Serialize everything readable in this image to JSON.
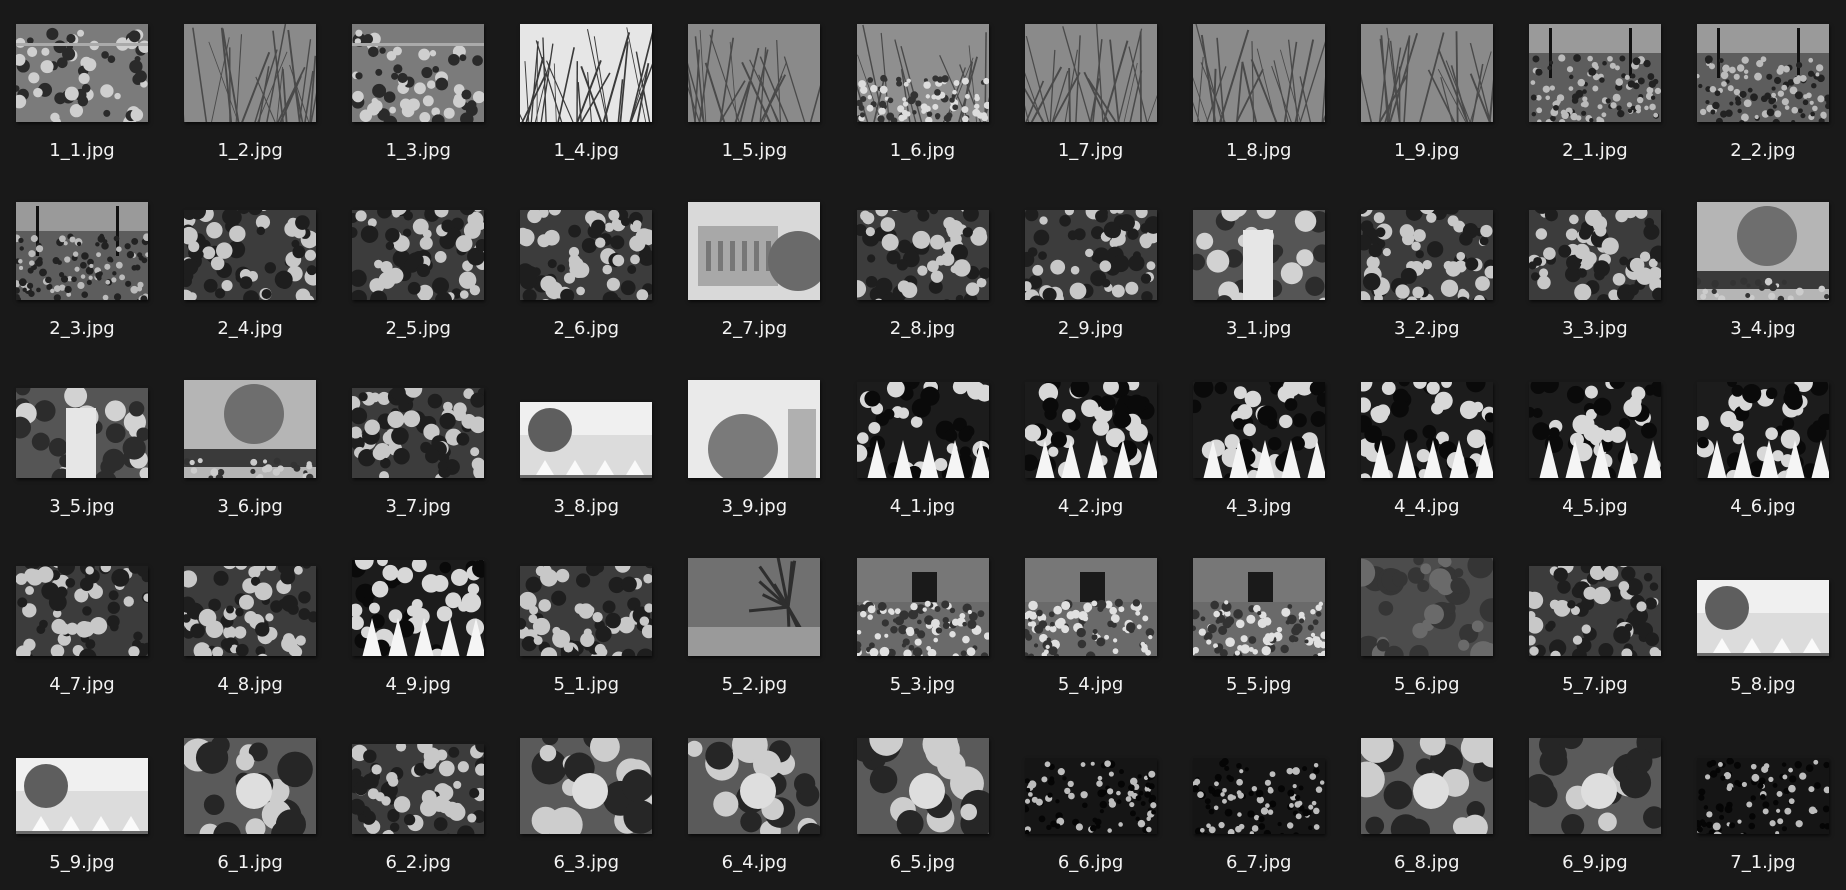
{
  "files": [
    {
      "name": "1_1.jpg",
      "scene": "crowd-edge"
    },
    {
      "name": "1_2.jpg",
      "scene": "trees"
    },
    {
      "name": "1_3.jpg",
      "scene": "crowd-edge"
    },
    {
      "name": "1_4.jpg",
      "scene": "bare-branches"
    },
    {
      "name": "1_5.jpg",
      "scene": "trees"
    },
    {
      "name": "1_6.jpg",
      "scene": "trees-crowd"
    },
    {
      "name": "1_7.jpg",
      "scene": "trees"
    },
    {
      "name": "1_8.jpg",
      "scene": "trees"
    },
    {
      "name": "1_9.jpg",
      "scene": "trees"
    },
    {
      "name": "2_1.jpg",
      "scene": "plaza"
    },
    {
      "name": "2_2.jpg",
      "scene": "plaza"
    },
    {
      "name": "2_3.jpg",
      "scene": "plaza"
    },
    {
      "name": "2_4.jpg",
      "scene": "crowd-close"
    },
    {
      "name": "2_5.jpg",
      "scene": "crowd-close"
    },
    {
      "name": "2_6.jpg",
      "scene": "crowd-close"
    },
    {
      "name": "2_7.jpg",
      "scene": "building"
    },
    {
      "name": "2_8.jpg",
      "scene": "crowd-close"
    },
    {
      "name": "2_9.jpg",
      "scene": "crowd-close"
    },
    {
      "name": "3_1.jpg",
      "scene": "people"
    },
    {
      "name": "3_2.jpg",
      "scene": "crowd-close"
    },
    {
      "name": "3_3.jpg",
      "scene": "crowd-close"
    },
    {
      "name": "3_4.jpg",
      "scene": "street"
    },
    {
      "name": "3_5.jpg",
      "scene": "people"
    },
    {
      "name": "3_6.jpg",
      "scene": "street"
    },
    {
      "name": "3_7.jpg",
      "scene": "crowd-close"
    },
    {
      "name": "3_8.jpg",
      "scene": "tents"
    },
    {
      "name": "3_9.jpg",
      "scene": "bright-trees"
    },
    {
      "name": "4_1.jpg",
      "scene": "formal-crowd"
    },
    {
      "name": "4_2.jpg",
      "scene": "formal-crowd"
    },
    {
      "name": "4_3.jpg",
      "scene": "formal-crowd"
    },
    {
      "name": "4_4.jpg",
      "scene": "formal-crowd"
    },
    {
      "name": "4_5.jpg",
      "scene": "formal-crowd"
    },
    {
      "name": "4_6.jpg",
      "scene": "formal-crowd"
    },
    {
      "name": "4_7.jpg",
      "scene": "crowd-close"
    },
    {
      "name": "4_8.jpg",
      "scene": "crowd-close"
    },
    {
      "name": "4_9.jpg",
      "scene": "formal-crowd"
    },
    {
      "name": "5_1.jpg",
      "scene": "crowd-close"
    },
    {
      "name": "5_2.jpg",
      "scene": "palm"
    },
    {
      "name": "5_3.jpg",
      "scene": "building-crowd"
    },
    {
      "name": "5_4.jpg",
      "scene": "building-crowd"
    },
    {
      "name": "5_5.jpg",
      "scene": "building-crowd"
    },
    {
      "name": "5_6.jpg",
      "scene": "foliage"
    },
    {
      "name": "5_7.jpg",
      "scene": "crowd-close"
    },
    {
      "name": "5_8.jpg",
      "scene": "tents"
    },
    {
      "name": "5_9.jpg",
      "scene": "tents"
    },
    {
      "name": "6_1.jpg",
      "scene": "faces"
    },
    {
      "name": "6_2.jpg",
      "scene": "crowd-close"
    },
    {
      "name": "6_3.jpg",
      "scene": "faces"
    },
    {
      "name": "6_4.jpg",
      "scene": "faces"
    },
    {
      "name": "6_5.jpg",
      "scene": "faces"
    },
    {
      "name": "6_6.jpg",
      "scene": "night-crowd"
    },
    {
      "name": "6_7.jpg",
      "scene": "night-crowd"
    },
    {
      "name": "6_8.jpg",
      "scene": "faces"
    },
    {
      "name": "6_9.jpg",
      "scene": "faces"
    },
    {
      "name": "7_1.jpg",
      "scene": "night-crowd"
    }
  ]
}
